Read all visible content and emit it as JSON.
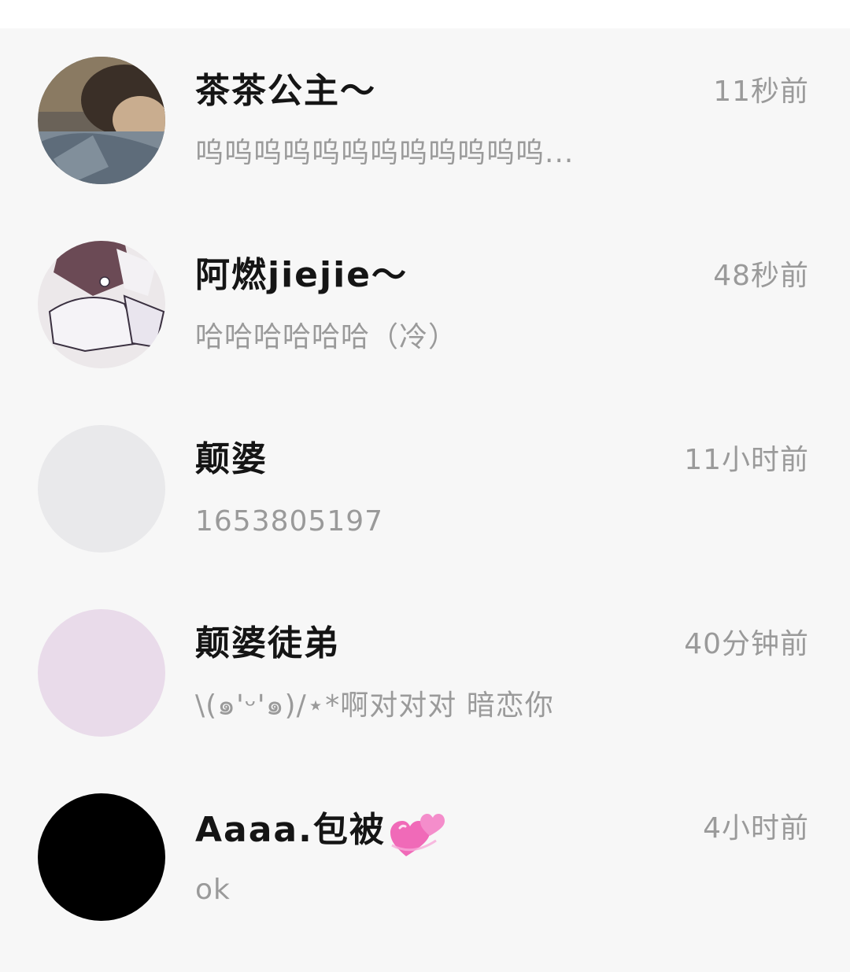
{
  "chats": [
    {
      "name": "茶茶公主～",
      "time": "11秒前",
      "preview": "呜呜呜呜呜呜呜呜呜呜呜呜...",
      "avatar_color": "#5f5a52"
    },
    {
      "name": "阿燃jiejie～",
      "time": "48秒前",
      "preview": "哈哈哈哈哈哈（冷）",
      "avatar_color": "#e8e2e6"
    },
    {
      "name": "颠婆",
      "time": "11小时前",
      "preview": "1653805197",
      "avatar_color": "#e9e9eb"
    },
    {
      "name": "颠婆徒弟",
      "time": "40分钟前",
      "preview": "\\(๑'ᵕ'๑)/⋆*啊对对对 暗恋你",
      "avatar_color": "#e9dbea"
    },
    {
      "name": "Aaaa.包被",
      "name_emoji": "two-hearts-icon",
      "time": "4小时前",
      "preview": "ok",
      "avatar_color": "#000000"
    }
  ]
}
